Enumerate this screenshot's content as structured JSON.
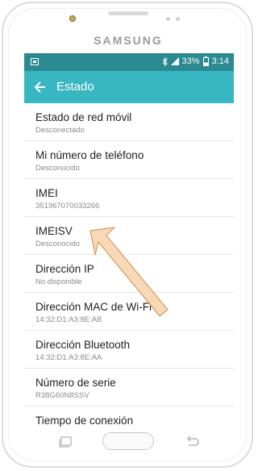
{
  "device": {
    "brand": "SAMSUNG"
  },
  "status_bar": {
    "battery": "33%",
    "time": "3:14",
    "icons": [
      "notification-icon",
      "bluetooth-icon",
      "signal-icon",
      "battery-icon"
    ]
  },
  "app_bar": {
    "title": "Estado",
    "back_icon": "arrow-left-icon"
  },
  "items": [
    {
      "title": "Estado de red móvil",
      "value": "Desconectado"
    },
    {
      "title": "Mi número de teléfono",
      "value": "Desconocido"
    },
    {
      "title": "IMEI",
      "value": "351967070033266"
    },
    {
      "title": "IMEISV",
      "value": "Desconocido"
    },
    {
      "title": "Dirección IP",
      "value": "No disponible"
    },
    {
      "title": "Dirección MAC de Wi-Fi",
      "value": "14:32:D1:A3:8E:AB"
    },
    {
      "title": "Dirección Bluetooth",
      "value": "14:32:D1:A3:8E:AA"
    },
    {
      "title": "Número de serie",
      "value": "R38G60N8SSV"
    },
    {
      "title": "Tiempo de conexión",
      "value": ""
    }
  ],
  "colors": {
    "status_bar": "#2b8a91",
    "app_bar": "#38b6c1",
    "arrow_fill": "#f6d2aa",
    "arrow_stroke": "#d99a5c"
  },
  "nav_keys": [
    "recent-apps-icon",
    "home-button",
    "back-key-icon"
  ]
}
